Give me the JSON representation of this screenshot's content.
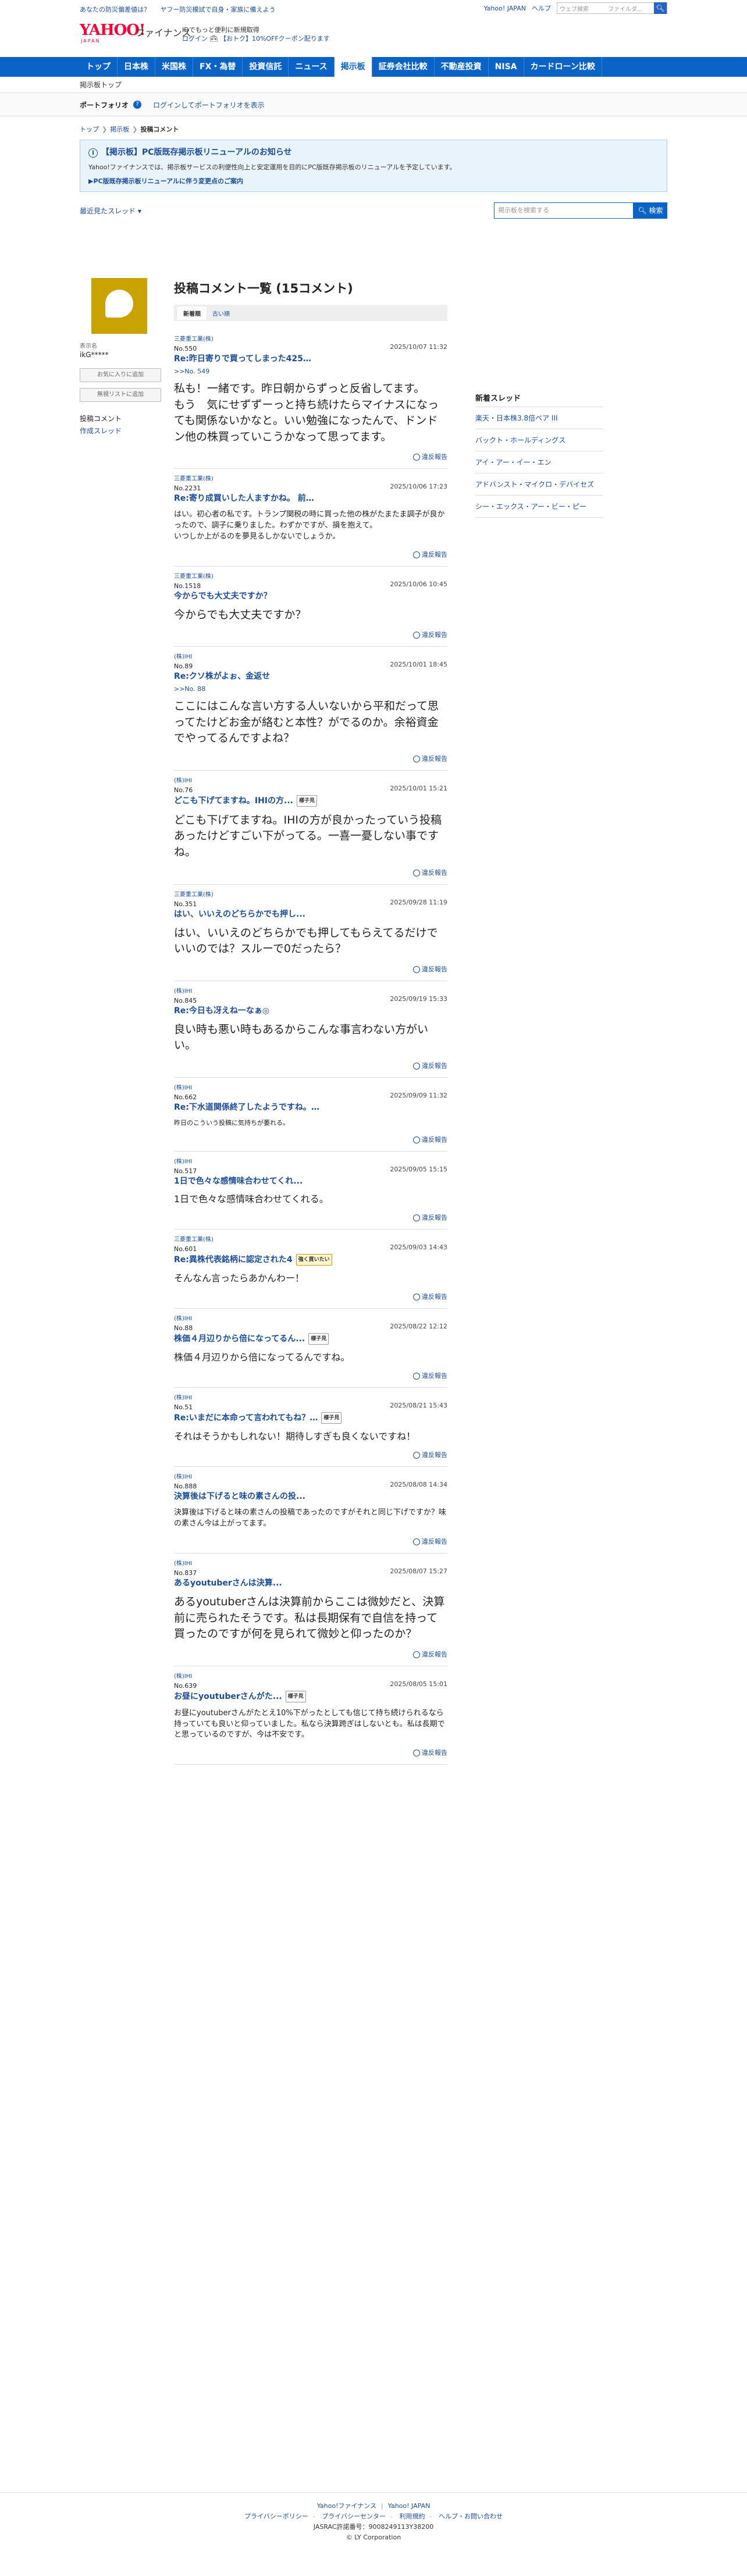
{
  "topbar": {
    "links": [
      "あなたの防災偏差値は？",
      "ヤフー防災模試で自身・家族に備えよう"
    ],
    "yahoo_japan": "Yahoo! JAPAN",
    "help": "ヘルプ",
    "search_placeholder": "ウェブ検索",
    "folder_label": "ファイルダ..."
  },
  "header": {
    "logo_text": "YAHOO!",
    "logo_sub": "JAPAN",
    "brand": "ファイナンス",
    "promo1": "IDでもっと便利に新規取得",
    "promo2": "ログイン",
    "promo3": "【おトク】10%OFFクーポン配ります"
  },
  "nav": {
    "items": [
      "トップ",
      "日本株",
      "米国株",
      "FX・為替",
      "投資信託",
      "ニュース",
      "掲示板",
      "証券会社比較",
      "不動産投資",
      "NISA",
      "カードローン比較"
    ],
    "active_index": 6
  },
  "subnav": {
    "label": "掲示板トップ"
  },
  "portfolio": {
    "title": "ポートフォリオ",
    "link": "ログインしてポートフォリオを表示"
  },
  "breadcrumb": [
    "トップ",
    "掲示板",
    "投稿コメント"
  ],
  "notice": {
    "title": "【掲示板】PC版既存掲示板リニューアルのお知らせ",
    "body": "Yahoo!ファイナンスでは、掲示板サービスの利便性向上と安定運用を目的にPC版既存掲示板のリニューアルを予定しています。",
    "link": "▶PC版既存掲示板リニューアルに伴う変更点のご案内"
  },
  "threadbar": {
    "recent": "最近見たスレッド ▾",
    "search_placeholder": "掲示板を検索する",
    "search_button": "検索"
  },
  "left": {
    "label": "表示名",
    "user": "ikG*****",
    "btn_fav": "お気に入りに追加",
    "btn_ignore": "無視リストに追加",
    "menu_title": "投稿コメント",
    "menu_link": "作成スレッド"
  },
  "main": {
    "title": "投稿コメント一覧 (15コメント)",
    "tabs": [
      "新着順",
      "古い順"
    ]
  },
  "posts": [
    {
      "company": "三菱重工業(株)",
      "no": "No.550",
      "date": "2025/10/07 11:32",
      "title": "Re:昨日寄りで買ってしまった425&hellip;",
      "tag": "",
      "reply": ">>No. 549",
      "body": "私も！一緒です。昨日朝からずっと反省してます。\nもう　気にせずずーっと持ち続けたらマイナスになっても関係ないかなと。いい勉強になったんで、ドンドン他の株買っていこうかなって思ってます。",
      "size": "l"
    },
    {
      "company": "三菱重工業(株)",
      "no": "No.2231",
      "date": "2025/10/06 17:23",
      "title": "Re:寄り成買いした人ますかね。 前&hellip;",
      "tag": "",
      "reply": "",
      "body": "はい。初心者の私です。トランプ関税の時に買った他の株がたまたま調子が良かったので、調子に乗りました。わずかですが、損を抱えて。\nいつしか上がるのを夢見るしかないでしょうか。",
      "size": "s"
    },
    {
      "company": "三菱重工業(株)",
      "no": "No.1518",
      "date": "2025/10/06 10:45",
      "title": "今からでも大丈夫ですか？",
      "tag": "",
      "reply": "",
      "body": "今からでも大丈夫ですか？",
      "size": "l"
    },
    {
      "company": "(株)IHI",
      "no": "No.89",
      "date": "2025/10/01 18:45",
      "title": "Re:クソ株がよぉ、金返せ",
      "tag": "",
      "reply": ">>No. 88",
      "body": "ここにはこんな言い方する人いないから平和だって思ってたけどお金が絡むと本性？がでるのか。余裕資金でやってるんですよね？",
      "size": "l"
    },
    {
      "company": "(株)IHI",
      "no": "No.76",
      "date": "2025/10/01 15:21",
      "title": "どこも下げてますね。IHIの方...",
      "tag": "様子見",
      "reply": "",
      "body": "どこも下げてますね。IHIの方が良かったっていう投稿あったけどすごい下がってる。一喜一憂しない事ですね。",
      "size": "l"
    },
    {
      "company": "三菱重工業(株)",
      "no": "No.351",
      "date": "2025/09/28 11:19",
      "title": "はい、いいえのどちらかでも押し...",
      "tag": "",
      "reply": "",
      "body": "はい、いいえのどちらかでも押してもらえてるだけでいいのでは？スルーで0だったら？",
      "size": "l"
    },
    {
      "company": "(株)IHI",
      "no": "No.845",
      "date": "2025/09/19 15:33",
      "title": "Re:今日も冴えね一なぁ◎",
      "tag": "",
      "reply": "",
      "body": "良い時も悪い時もあるからこんな事言わない方がいい。",
      "size": "l"
    },
    {
      "company": "(株)IHI",
      "no": "No.662",
      "date": "2025/09/09 11:32",
      "title": "Re:下水道関係終了したようですね。&hellip;",
      "tag": "",
      "reply": "",
      "body": "昨日のこういう投稿に気持ちが萎れる。",
      "size": "xs"
    },
    {
      "company": "(株)IHI",
      "no": "No.517",
      "date": "2025/09/05 15:15",
      "title": "1日で色々な感情味合わせてくれ...",
      "tag": "",
      "reply": "",
      "body": "1日で色々な感情味合わせてくれる。",
      "size": "m"
    },
    {
      "company": "三菱重工業(株)",
      "no": "No.601",
      "date": "2025/09/03 14:43",
      "title": "Re:異株代表銘柄に認定された4",
      "tag": "強く買いたい",
      "reply": "",
      "body": "そんなん言ったらあかんわー！",
      "size": "m"
    },
    {
      "company": "(株)IHI",
      "no": "No.88",
      "date": "2025/08/22 12:12",
      "title": "株価４月辺りから倍になってるん...",
      "tag": "様子見",
      "reply": "",
      "body": "株価４月辺りから倍になってるんですね。",
      "size": "m"
    },
    {
      "company": "(株)IHI",
      "no": "No.51",
      "date": "2025/08/21 15:43",
      "title": "Re:いまだに本命って言われてもね？&hellip;",
      "tag": "様子見",
      "reply": "",
      "body": "それはそうかもしれない！期待しすぎも良くないですね！",
      "size": "m"
    },
    {
      "company": "(株)IHI",
      "no": "No.888",
      "date": "2025/08/08 14:34",
      "title": "決算後は下げると味の素さんの投...",
      "tag": "",
      "reply": "",
      "body": "決算後は下げると味の素さんの投稿であったのですがそれと同じ下げですか？味の素さん今は上がってます。",
      "size": "s"
    },
    {
      "company": "(株)IHI",
      "no": "No.837",
      "date": "2025/08/07 15:27",
      "title": "あるyoutuberさんは決算...",
      "tag": "",
      "reply": "",
      "body": "あるyoutuberさんは決算前からここは微妙だと、決算前に売られたそうです。私は長期保有で自信を持って買ったのですが何を見られて微妙と仰ったのか？",
      "size": "l"
    },
    {
      "company": "(株)IHI",
      "no": "No.639",
      "date": "2025/08/05 15:01",
      "title": "お昼にyoutuberさんがた...",
      "tag": "様子見",
      "reply": "",
      "body": "お昼にyoutuberさんがたとえ10%下がったとしても信じて持ち続けられるなら持っていても良いと仰っていました。私なら決算跨ぎはしないとも。私は長期でと思っているのですが、今は不安です。",
      "size": "s"
    }
  ],
  "report_label": "違反報告",
  "right": {
    "title": "新着スレッド",
    "items": [
      "楽天・日本株3.8倍ベア III",
      "バックト・ホールディングス",
      "アイ・アー・イー・エン",
      "アドバンスト・マイクロ・デバイセズ",
      "シー・エックス・アー・ビー・ピー"
    ]
  },
  "footer": {
    "line1": [
      "Yahoo!ファイナンス",
      "Yahoo! JAPAN"
    ],
    "line2": [
      "プライバシーポリシー",
      "プライバシーセンター",
      "利用規約",
      "ヘルプ・お問い合わせ"
    ],
    "line3": "JASRAC許諾番号：9008249113Y38200",
    "line4": "© LY Corporation"
  },
  "colors": {
    "brand_red": "#ff0033",
    "nav_blue": "#0a64c8",
    "link_blue": "#1a4c9c",
    "avatar_yellow": "#c9a400"
  }
}
